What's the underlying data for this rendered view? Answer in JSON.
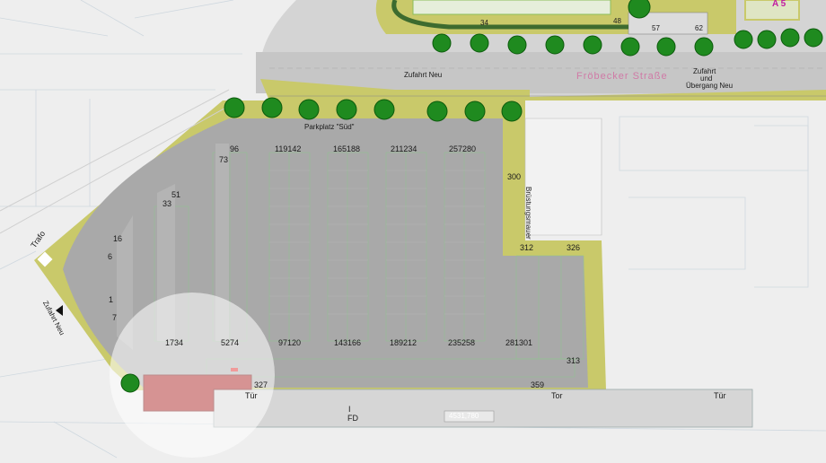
{
  "colors": {
    "road": "#c6c6c6",
    "lot": "#a9a9a9",
    "green": "#c9c96a",
    "building_red": "#a51010",
    "street_label": "#d07aa6",
    "badge": "#c21aa0"
  },
  "labels": {
    "zufahrt_top": "Zufahrt Neu",
    "street": "Fröbecker Straße",
    "zufahrt_right_1": "Zufahrt",
    "zufahrt_right_2": "und",
    "zufahrt_right_3": "Übergang Neu",
    "parkplatz": "Parkplatz \"Süd\"",
    "trafo": "Trafo",
    "zufahrt_left": "Zufahrt Neu",
    "bruestungsmauer": "Brüstungsmauer",
    "tuer_1": "Tür",
    "tuer_2": "Tür",
    "tor": "Tor",
    "fd": "FD",
    "i_mark": "I",
    "badge": "A 5",
    "plate": "4531,780"
  },
  "numbers": {
    "n34": "34",
    "n48": "48",
    "n57": "57",
    "n62": "62",
    "p96": "96",
    "p73": "73",
    "p51": "51",
    "p33": "33",
    "p16": "16",
    "p6": "6",
    "p1": "1",
    "p7": "7",
    "r119142": "119142",
    "r165188": "165188",
    "r211234": "211234",
    "r257280": "257280",
    "b1734": "1734",
    "b5274": "5274",
    "b97120": "97120",
    "b143166": "143166",
    "b189212": "189212",
    "b235258": "235258",
    "b281301": "281301",
    "p300": "300",
    "p312": "312",
    "p326": "326",
    "p313": "313",
    "p327": "327",
    "p359": "359"
  },
  "trees": [
    "tree-row-top",
    "tree-row-street"
  ]
}
